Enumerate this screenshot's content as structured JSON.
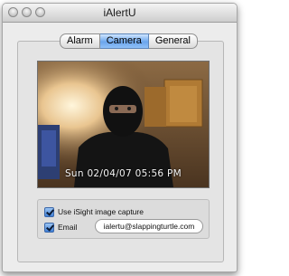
{
  "window": {
    "title": "iAlertU"
  },
  "tabs": [
    {
      "label": "Alarm",
      "selected": false
    },
    {
      "label": "Camera",
      "selected": true
    },
    {
      "label": "General",
      "selected": false
    }
  ],
  "camera": {
    "timestamp": "Sun 02/04/07 05:56 PM"
  },
  "options": {
    "isight_capture": {
      "label": "Use iSight image capture",
      "checked": true
    },
    "email": {
      "label": "Email",
      "checked": true,
      "value": "ialertu@slappingturtle.com"
    }
  },
  "colors": {
    "selected_tab": "#6ba5ec",
    "checkbox": "#3f7fd6",
    "window_bg": "#ececec"
  }
}
